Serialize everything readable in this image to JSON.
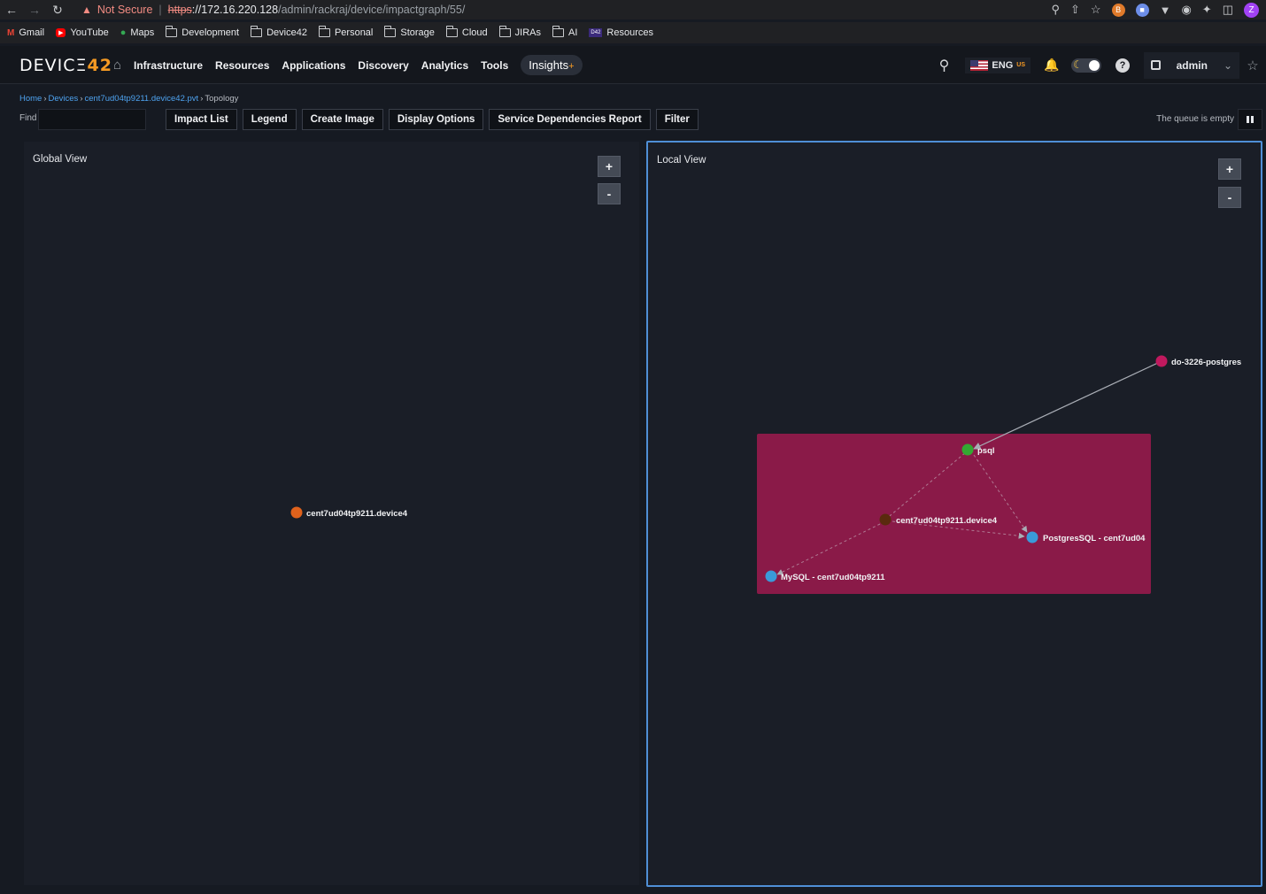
{
  "browser": {
    "warning": "Not Secure",
    "url_scheme": "https",
    "url_host": "://172.16.220.128",
    "url_path": "/admin/rackraj/device/impactgraph/55/",
    "profile_initial": "Z",
    "bookmarks": [
      "Gmail",
      "YouTube",
      "Maps",
      "Development",
      "Device42",
      "Personal",
      "Storage",
      "Cloud",
      "JIRAs",
      "AI",
      "Resources"
    ]
  },
  "header": {
    "logo_text": "DEVICΞ",
    "logo_num": "42",
    "nav": [
      "Infrastructure",
      "Resources",
      "Applications",
      "Discovery",
      "Analytics",
      "Tools"
    ],
    "insights": "Insights",
    "lang": "ENG",
    "lang_region": "US",
    "user": "admin"
  },
  "breadcrumb": {
    "home": "Home",
    "devices": "Devices",
    "device": "cent7ud04tp9211.device42.pvt",
    "current": "Topology"
  },
  "toolbar": {
    "find_label": "Find",
    "find_value": "",
    "buttons": [
      "Impact List",
      "Legend",
      "Create Image",
      "Display Options",
      "Service Dependencies Report",
      "Filter"
    ],
    "queue_status": "The queue is empty"
  },
  "global_view": {
    "title": "Global View",
    "zoom_in": "+",
    "zoom_out": "-",
    "nodes": [
      {
        "label": "cent7ud04tp9211.device4",
        "color": "#e0621c"
      }
    ]
  },
  "local_view": {
    "title": "Local View",
    "zoom_in": "+",
    "zoom_out": "-",
    "group_color": "#8a1a48",
    "nodes": [
      {
        "id": "pg",
        "label": "do-3226-postgres",
        "color": "#c0195e"
      },
      {
        "id": "psql",
        "label": "psql",
        "color": "#34a832"
      },
      {
        "id": "dev",
        "label": "cent7ud04tp9211.device4",
        "color": "#5a2a0e"
      },
      {
        "id": "pgsql",
        "label": "PostgresSQL - cent7ud04",
        "color": "#3a9ad9"
      },
      {
        "id": "mysql",
        "label": "MySQL - cent7ud04tp9211",
        "color": "#3a9ad9"
      }
    ]
  }
}
